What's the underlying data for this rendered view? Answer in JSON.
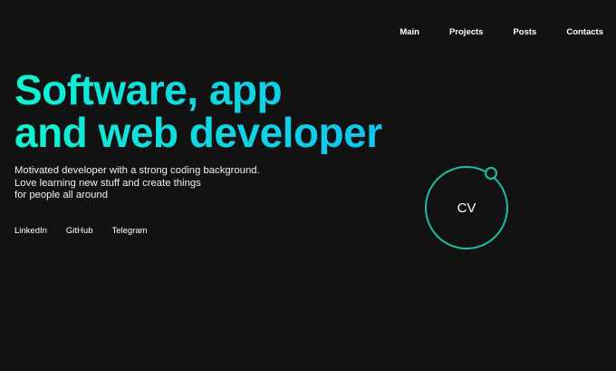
{
  "nav": {
    "items": [
      "Main",
      "Projects",
      "Posts",
      "Contacts"
    ]
  },
  "hero": {
    "line1": "Software, app",
    "line2": "and web developer"
  },
  "description": {
    "line1": "Motivated developer with a strong coding background.",
    "line2": "Love learning new stuff and create things",
    "line3": "for people all around"
  },
  "social": [
    "LinkedIn",
    "GitHub",
    "Telegram"
  ],
  "cv": {
    "label": "CV"
  },
  "colors": {
    "background": "#121212",
    "gradient_start": "#12f2d0",
    "gradient_end": "#10c6f0",
    "ring": "#1bbfa3"
  }
}
